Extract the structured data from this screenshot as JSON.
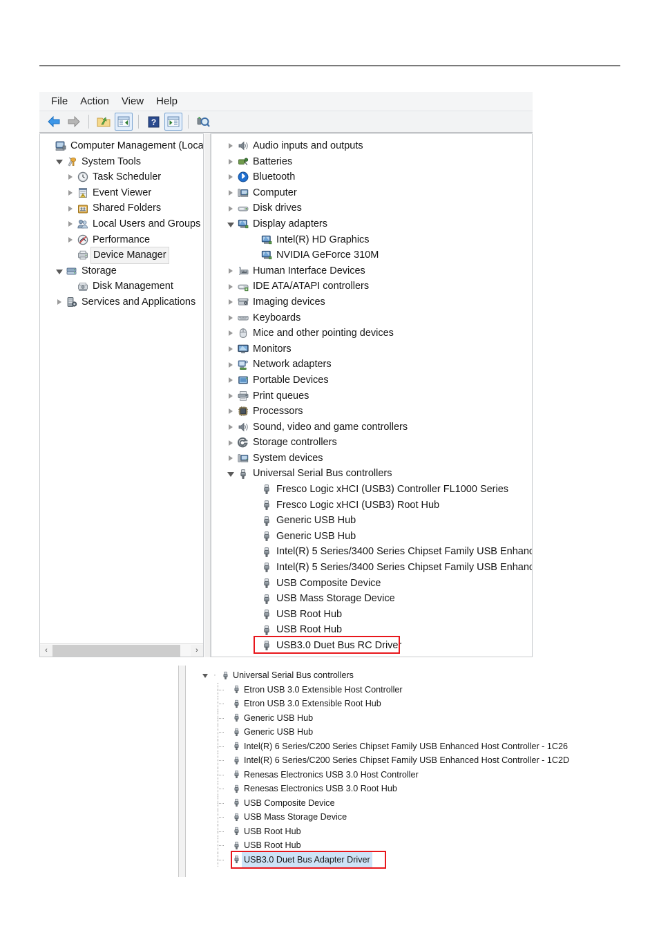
{
  "window": {
    "menu": [
      {
        "label": "File",
        "name": "menu-file"
      },
      {
        "label": "Action",
        "name": "menu-action"
      },
      {
        "label": "View",
        "name": "menu-view"
      },
      {
        "label": "Help",
        "name": "menu-help"
      }
    ],
    "toolbar": [
      {
        "icon": "back-arrow-icon",
        "label": "Back"
      },
      {
        "icon": "forward-arrow-icon",
        "label": "Forward"
      },
      {
        "icon": "up-folder-icon",
        "label": "Up one level"
      },
      {
        "icon": "show-hide-console-tree-icon",
        "label": "Show/Hide Console Tree"
      },
      {
        "icon": "help-icon",
        "label": "Help"
      },
      {
        "icon": "properties-icon",
        "label": "Properties"
      },
      {
        "icon": "scan-hardware-changes-icon",
        "label": "Scan for hardware changes"
      }
    ]
  },
  "console_tree": {
    "items": [
      {
        "label": "Computer Management (Local",
        "indent": 0,
        "state": "root",
        "icon": "computer-management-icon"
      },
      {
        "label": "System Tools",
        "indent": 1,
        "state": "expanded",
        "icon": "system-tools-icon"
      },
      {
        "label": "Task Scheduler",
        "indent": 2,
        "state": "collapsed",
        "icon": "task-scheduler-icon"
      },
      {
        "label": "Event Viewer",
        "indent": 2,
        "state": "collapsed",
        "icon": "event-viewer-icon"
      },
      {
        "label": "Shared Folders",
        "indent": 2,
        "state": "collapsed",
        "icon": "shared-folders-icon"
      },
      {
        "label": "Local Users and Groups",
        "indent": 2,
        "state": "collapsed",
        "icon": "local-users-groups-icon"
      },
      {
        "label": "Performance",
        "indent": 2,
        "state": "collapsed",
        "icon": "performance-icon"
      },
      {
        "label": "Device Manager",
        "indent": 2,
        "state": "selected",
        "icon": "device-manager-icon"
      },
      {
        "label": "Storage",
        "indent": 1,
        "state": "expanded",
        "icon": "storage-icon"
      },
      {
        "label": "Disk Management",
        "indent": 2,
        "state": "leaf",
        "icon": "disk-management-icon"
      },
      {
        "label": "Services and Applications",
        "indent": 1,
        "state": "collapsed",
        "icon": "services-applications-icon"
      }
    ]
  },
  "device_tree": {
    "items": [
      {
        "label": "Audio inputs and outputs",
        "indent": 0,
        "state": "collapsed",
        "icon": "speaker-icon"
      },
      {
        "label": "Batteries",
        "indent": 0,
        "state": "collapsed",
        "icon": "battery-icon"
      },
      {
        "label": "Bluetooth",
        "indent": 0,
        "state": "collapsed",
        "icon": "bluetooth-icon"
      },
      {
        "label": "Computer",
        "indent": 0,
        "state": "collapsed",
        "icon": "computer-icon"
      },
      {
        "label": "Disk drives",
        "indent": 0,
        "state": "collapsed",
        "icon": "disk-drive-icon"
      },
      {
        "label": "Display adapters",
        "indent": 0,
        "state": "expanded",
        "icon": "display-adapter-icon"
      },
      {
        "label": "Intel(R) HD Graphics",
        "indent": 1,
        "state": "leaf",
        "icon": "display-adapter-icon"
      },
      {
        "label": "NVIDIA GeForce 310M",
        "indent": 1,
        "state": "leaf",
        "icon": "display-adapter-icon"
      },
      {
        "label": "Human Interface Devices",
        "indent": 0,
        "state": "collapsed",
        "icon": "hid-icon"
      },
      {
        "label": "IDE ATA/ATAPI controllers",
        "indent": 0,
        "state": "collapsed",
        "icon": "ide-controller-icon"
      },
      {
        "label": "Imaging devices",
        "indent": 0,
        "state": "collapsed",
        "icon": "imaging-device-icon"
      },
      {
        "label": "Keyboards",
        "indent": 0,
        "state": "collapsed",
        "icon": "keyboard-icon"
      },
      {
        "label": "Mice and other pointing devices",
        "indent": 0,
        "state": "collapsed",
        "icon": "mouse-icon"
      },
      {
        "label": "Monitors",
        "indent": 0,
        "state": "collapsed",
        "icon": "monitor-icon"
      },
      {
        "label": "Network adapters",
        "indent": 0,
        "state": "collapsed",
        "icon": "network-adapter-icon"
      },
      {
        "label": "Portable Devices",
        "indent": 0,
        "state": "collapsed",
        "icon": "portable-device-icon"
      },
      {
        "label": "Print queues",
        "indent": 0,
        "state": "collapsed",
        "icon": "printer-icon"
      },
      {
        "label": "Processors",
        "indent": 0,
        "state": "collapsed",
        "icon": "processor-icon"
      },
      {
        "label": "Sound, video and game controllers",
        "indent": 0,
        "state": "collapsed",
        "icon": "speaker-icon"
      },
      {
        "label": "Storage controllers",
        "indent": 0,
        "state": "collapsed",
        "icon": "storage-controller-icon"
      },
      {
        "label": "System devices",
        "indent": 0,
        "state": "collapsed",
        "icon": "computer-icon"
      },
      {
        "label": "Universal Serial Bus controllers",
        "indent": 0,
        "state": "expanded",
        "icon": "usb-icon"
      },
      {
        "label": "Fresco Logic xHCI (USB3) Controller FL1000 Series",
        "indent": 1,
        "state": "leaf",
        "icon": "usb-icon"
      },
      {
        "label": "Fresco Logic xHCI (USB3) Root Hub",
        "indent": 1,
        "state": "leaf",
        "icon": "usb-icon"
      },
      {
        "label": "Generic USB Hub",
        "indent": 1,
        "state": "leaf",
        "icon": "usb-icon"
      },
      {
        "label": "Generic USB Hub",
        "indent": 1,
        "state": "leaf",
        "icon": "usb-icon"
      },
      {
        "label": "Intel(R) 5 Series/3400 Series Chipset Family USB Enhanc",
        "indent": 1,
        "state": "leaf",
        "icon": "usb-icon"
      },
      {
        "label": "Intel(R) 5 Series/3400 Series Chipset Family USB Enhanc",
        "indent": 1,
        "state": "leaf",
        "icon": "usb-icon"
      },
      {
        "label": "USB Composite Device",
        "indent": 1,
        "state": "leaf",
        "icon": "usb-icon"
      },
      {
        "label": "USB Mass Storage Device",
        "indent": 1,
        "state": "leaf",
        "icon": "usb-icon"
      },
      {
        "label": "USB Root Hub",
        "indent": 1,
        "state": "leaf",
        "icon": "usb-icon"
      },
      {
        "label": "USB Root Hub",
        "indent": 1,
        "state": "leaf",
        "icon": "usb-icon"
      },
      {
        "label": "USB3.0 Duet Bus RC Driver",
        "indent": 1,
        "state": "leaf",
        "icon": "usb-icon",
        "highlighted": true
      }
    ]
  },
  "lower_device_tree": {
    "items": [
      {
        "label": "Universal Serial Bus controllers",
        "root": true,
        "icon": "usb-icon"
      },
      {
        "label": "Etron USB 3.0 Extensible Host Controller",
        "root": false,
        "icon": "usb-icon"
      },
      {
        "label": "Etron USB 3.0 Extensible Root Hub",
        "root": false,
        "icon": "usb-icon"
      },
      {
        "label": "Generic USB Hub",
        "root": false,
        "icon": "usb-icon"
      },
      {
        "label": "Generic USB Hub",
        "root": false,
        "icon": "usb-icon"
      },
      {
        "label": "Intel(R) 6 Series/C200 Series Chipset Family USB Enhanced Host Controller - 1C26",
        "root": false,
        "icon": "usb-icon"
      },
      {
        "label": "Intel(R) 6 Series/C200 Series Chipset Family USB Enhanced Host Controller - 1C2D",
        "root": false,
        "icon": "usb-icon"
      },
      {
        "label": "Renesas Electronics USB 3.0 Host Controller",
        "root": false,
        "icon": "usb-icon"
      },
      {
        "label": "Renesas Electronics USB 3.0 Root Hub",
        "root": false,
        "icon": "usb-icon"
      },
      {
        "label": "USB Composite Device",
        "root": false,
        "icon": "usb-icon"
      },
      {
        "label": "USB Mass Storage Device",
        "root": false,
        "icon": "usb-icon"
      },
      {
        "label": "USB Root Hub",
        "root": false,
        "icon": "usb-icon"
      },
      {
        "label": "USB Root Hub",
        "root": false,
        "icon": "usb-icon"
      },
      {
        "label": "USB3.0 Duet Bus Adapter Driver",
        "root": false,
        "icon": "usb-icon",
        "selected": true,
        "highlighted": true
      }
    ]
  },
  "scrollbar": {
    "left_arrow": "‹",
    "right_arrow": "›"
  },
  "colors": {
    "highlight_box": "#e8161b",
    "selection": "#cde3f7",
    "toolbar_active": "#e3eefb"
  }
}
